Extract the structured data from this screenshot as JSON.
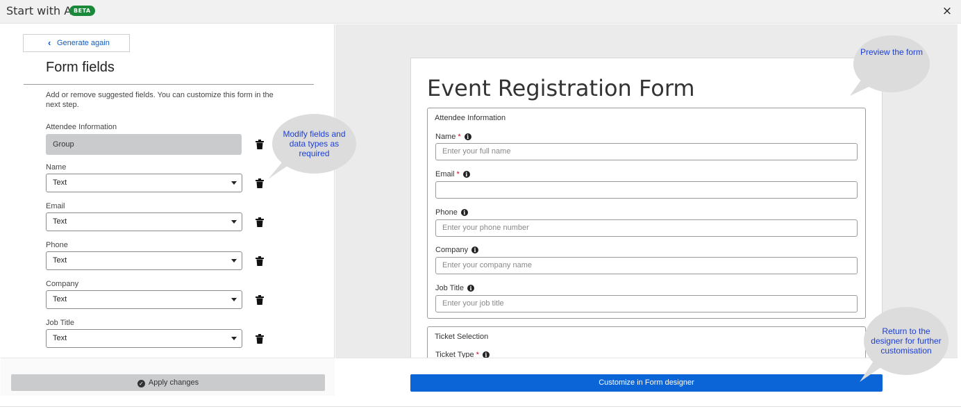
{
  "header": {
    "title": "Start with AI",
    "badge": "BETA",
    "close": "×"
  },
  "left_panel": {
    "back_button": "Generate again",
    "title": "Form fields",
    "description": "Add or remove suggested fields. You can customize this form in the next step.",
    "fields": [
      {
        "label": "Attendee Information",
        "value": "Group",
        "kind": "group"
      },
      {
        "label": "Name",
        "value": "Text",
        "kind": "select"
      },
      {
        "label": "Email",
        "value": "Text",
        "kind": "select"
      },
      {
        "label": "Phone",
        "value": "Text",
        "kind": "select"
      },
      {
        "label": "Company",
        "value": "Text",
        "kind": "select"
      },
      {
        "label": "Job Title",
        "value": "Text",
        "kind": "select"
      }
    ]
  },
  "preview": {
    "title": "Event Registration Form",
    "section1": {
      "legend": "Attendee Information",
      "fields": [
        {
          "label": "Name",
          "required": "*",
          "placeholder": "Enter your full name"
        },
        {
          "label": "Email",
          "required": "*",
          "placeholder": ""
        },
        {
          "label": "Phone",
          "required": "",
          "placeholder": "Enter your phone number"
        },
        {
          "label": "Company",
          "required": "",
          "placeholder": "Enter your company name"
        },
        {
          "label": "Job Title",
          "required": "",
          "placeholder": "Enter your job title"
        }
      ]
    },
    "section2": {
      "legend": "Ticket Selection",
      "field_label": "Ticket Type",
      "required": "*"
    }
  },
  "callouts": {
    "modify": "Modify fields and data types as required",
    "preview": "Preview the form",
    "return": "Return to the designer for further customisation"
  },
  "footer": {
    "apply_button": "Apply changes",
    "customize_button": "Customize in Form designer"
  },
  "colors": {
    "accent_blue": "#0b65d6",
    "beta_green": "#1a8a3a",
    "required_red": "#d0021b",
    "callout_text": "#1d3fd1"
  }
}
